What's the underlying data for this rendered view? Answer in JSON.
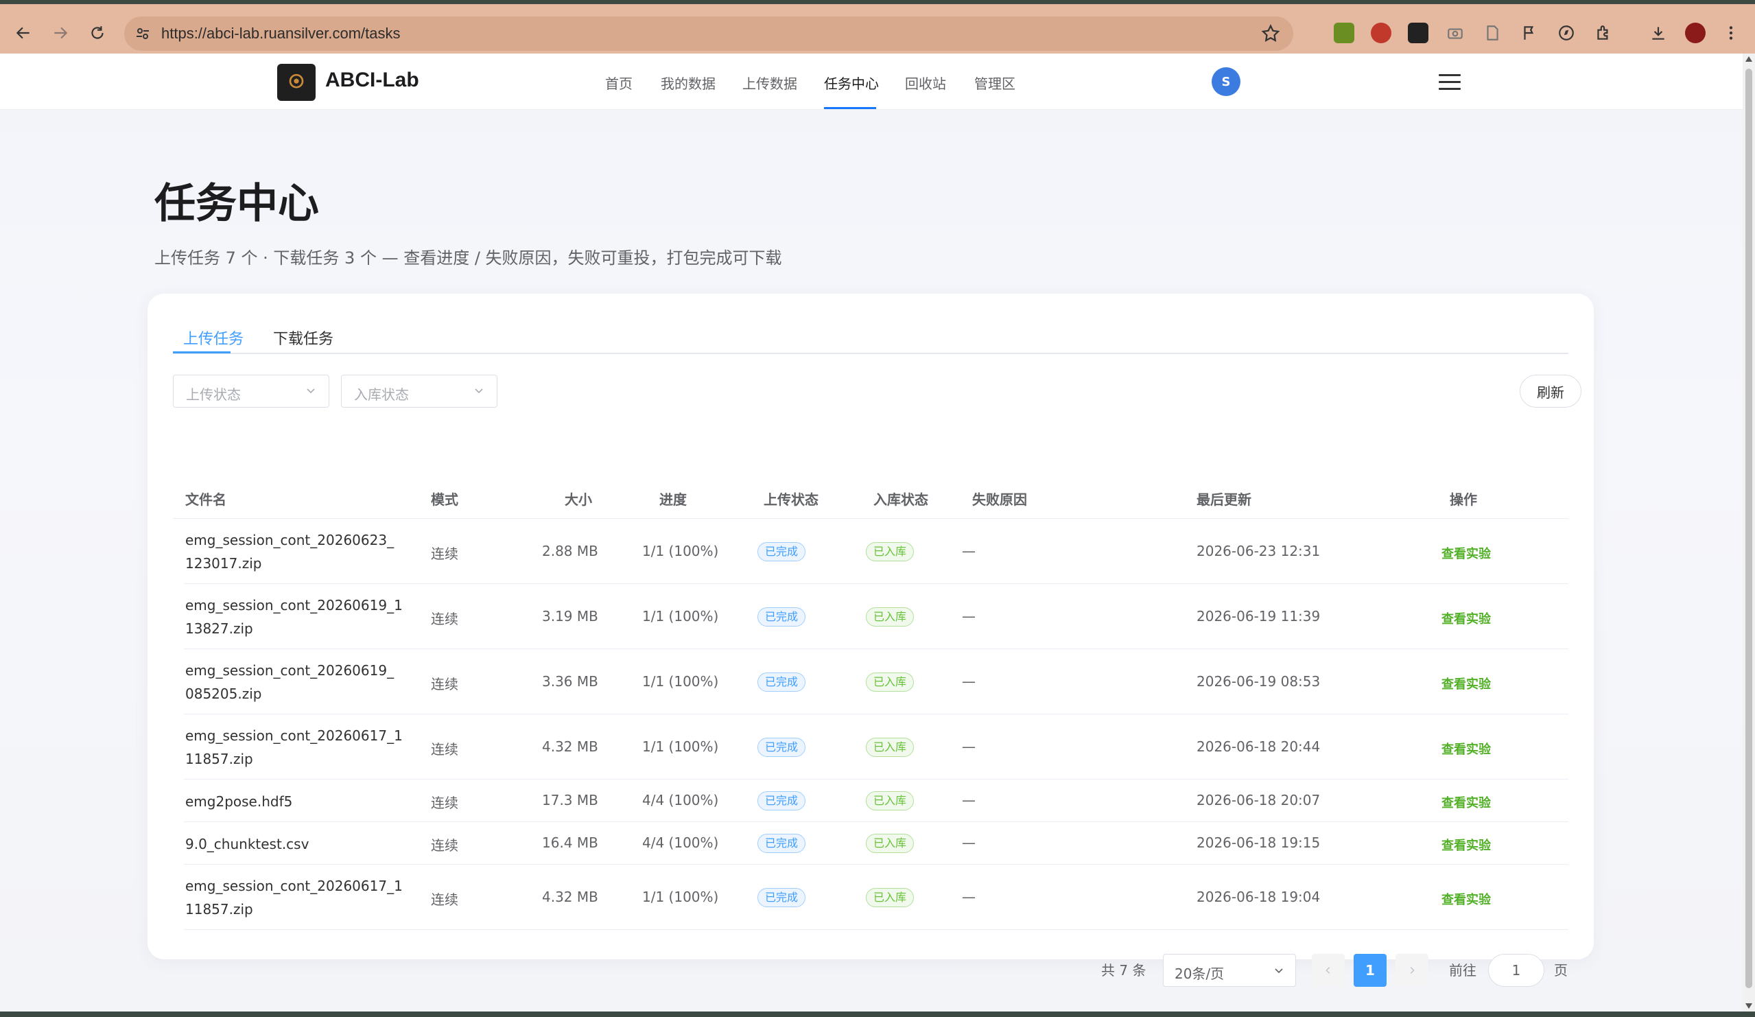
{
  "browser": {
    "url": "https://abci-lab.ruansilver.com/tasks"
  },
  "nav": {
    "brand": "ABCI-Lab",
    "items": [
      "首页",
      "我的数据",
      "上传数据",
      "任务中心",
      "回收站",
      "管理区"
    ],
    "active": "任务中心",
    "avatar_initial": "S"
  },
  "header": {
    "title": "任务中心",
    "subtitle": "上传任务 7 个 · 下载任务 3 个 — 查看进度 / 失败原因，失败可重投，打包完成可下载"
  },
  "tabs": [
    "上传任务",
    "下载任务"
  ],
  "filters": {
    "upload_status_placeholder": "上传状态",
    "ingest_status_placeholder": "入库状态",
    "refresh_label": "刷新"
  },
  "table": {
    "columns": [
      "文件名",
      "模式",
      "大小",
      "进度",
      "上传状态",
      "入库状态",
      "失败原因",
      "最后更新",
      "操作"
    ],
    "rows": [
      {
        "file": "emg_session_cont_20260623_\n123017.zip",
        "mode": "连续",
        "size": "2.88 MB",
        "progress": "1/1 (100%)",
        "upload": "已完成",
        "ingest": "已入库",
        "reason": "—",
        "updated": "2026-06-23 12:31",
        "action": "查看实验"
      },
      {
        "file": "emg_session_cont_20260619_1\n13827.zip",
        "mode": "连续",
        "size": "3.19 MB",
        "progress": "1/1 (100%)",
        "upload": "已完成",
        "ingest": "已入库",
        "reason": "—",
        "updated": "2026-06-19 11:39",
        "action": "查看实验"
      },
      {
        "file": "emg_session_cont_20260619_\n085205.zip",
        "mode": "连续",
        "size": "3.36 MB",
        "progress": "1/1 (100%)",
        "upload": "已完成",
        "ingest": "已入库",
        "reason": "—",
        "updated": "2026-06-19 08:53",
        "action": "查看实验"
      },
      {
        "file": "emg_session_cont_20260617_1\n11857.zip",
        "mode": "连续",
        "size": "4.32 MB",
        "progress": "1/1 (100%)",
        "upload": "已完成",
        "ingest": "已入库",
        "reason": "—",
        "updated": "2026-06-18 20:44",
        "action": "查看实验"
      },
      {
        "file": "emg2pose.hdf5",
        "mode": "连续",
        "size": "17.3 MB",
        "progress": "4/4 (100%)",
        "upload": "已完成",
        "ingest": "已入库",
        "reason": "—",
        "updated": "2026-06-18 20:07",
        "action": "查看实验"
      },
      {
        "file": "9.0_chunktest.csv",
        "mode": "连续",
        "size": "16.4 MB",
        "progress": "4/4 (100%)",
        "upload": "已完成",
        "ingest": "已入库",
        "reason": "—",
        "updated": "2026-06-18 19:15",
        "action": "查看实验"
      },
      {
        "file": "emg_session_cont_20260617_1\n11857.zip",
        "mode": "连续",
        "size": "4.32 MB",
        "progress": "1/1 (100%)",
        "upload": "已完成",
        "ingest": "已入库",
        "reason": "—",
        "updated": "2026-06-18 19:04",
        "action": "查看实验"
      }
    ]
  },
  "pagination": {
    "total": "共 7 条",
    "page_size": "20条/页",
    "current_page": "1",
    "goto_label": "前往",
    "goto_value": "1",
    "page_suffix": "页"
  },
  "colors": {
    "primary": "#409eff",
    "success": "#67c23a",
    "browser_bar": "#e4b9a0"
  }
}
